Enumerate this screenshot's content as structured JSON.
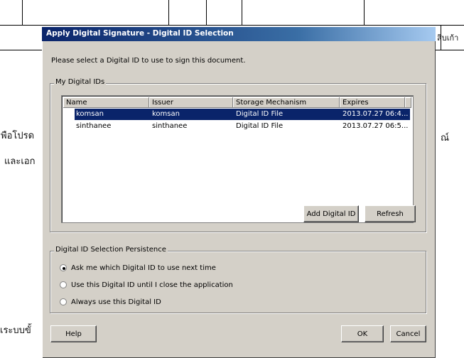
{
  "background": {
    "text_top_right": "สิบเก้า",
    "text_left_1": "พือโปรด",
    "text_left_2": "และเอก",
    "text_right_1": "ณ์",
    "text_bottom_left": "เระบบขั้"
  },
  "dialog": {
    "title": "Apply Digital Signature - Digital ID Selection",
    "prompt": "Please select a Digital ID to use to sign this document.",
    "my_ids_group": {
      "label": "My Digital IDs",
      "columns": [
        "Name",
        "Issuer",
        "Storage Mechanism",
        "Expires"
      ],
      "rows": [
        {
          "name": "komsan",
          "issuer": "komsan",
          "storage": "Digital ID File",
          "expires": "2013.07.27 06:4...",
          "selected": true
        },
        {
          "name": "sinthanee",
          "issuer": "sinthanee",
          "storage": "Digital ID File",
          "expires": "2013.07.27 06:5...",
          "selected": false
        }
      ],
      "add_button": "Add Digital ID",
      "refresh_button": "Refresh"
    },
    "persistence_group": {
      "label": "Digital ID Selection Persistence",
      "options": [
        {
          "label": "Ask me which Digital ID to use next time",
          "checked": true
        },
        {
          "label": "Use this Digital ID until I close the application",
          "checked": false
        },
        {
          "label": "Always use this Digital ID",
          "checked": false
        }
      ]
    },
    "help_button": "Help",
    "ok_button": "OK",
    "cancel_button": "Cancel"
  }
}
